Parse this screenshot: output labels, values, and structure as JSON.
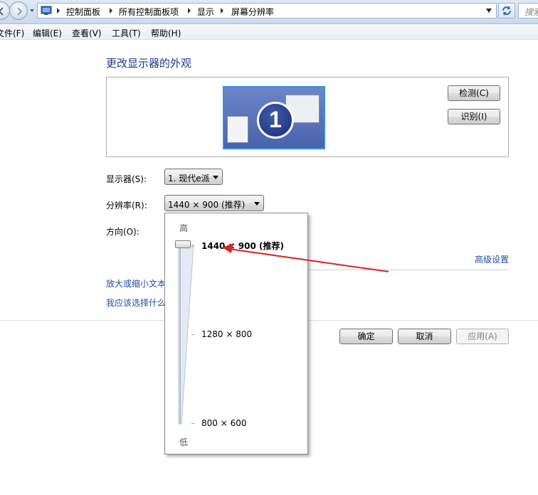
{
  "address_bar": {
    "breadcrumbs": [
      "控制面板",
      "所有控制面板项",
      "显示",
      "屏幕分辨率"
    ],
    "search_placeholder": "搜索"
  },
  "menu": {
    "items": [
      "文件(F)",
      "编辑(E)",
      "查看(V)",
      "工具(T)",
      "帮助(H)"
    ]
  },
  "main": {
    "title": "更改显示器的外观",
    "monitor_number": "1",
    "detect_button": "检测(C)",
    "identify_button": "识别(I)",
    "display_label": "显示器(S):",
    "display_value": "1. 现代e派",
    "resolution_label": "分辨率(R):",
    "resolution_value": "1440 × 900 (推荐)",
    "orientation_label": "方向(O):",
    "advanced_link": "高级设置",
    "link_text_size": "放大或缩小文本",
    "link_what_settings": "我应该选择什么",
    "ok_button": "确定",
    "cancel_button": "取消",
    "apply_button": "应用(A)"
  },
  "resolution_popup": {
    "high_label": "高",
    "low_label": "低",
    "options": [
      "1440 × 900 (推荐)",
      "1280 × 800",
      "800 × 600"
    ],
    "selected_index": 0
  },
  "colors": {
    "title_blue": "#1e3a8a",
    "link_blue": "#1e4fa8",
    "annotation_red": "#e02424"
  }
}
